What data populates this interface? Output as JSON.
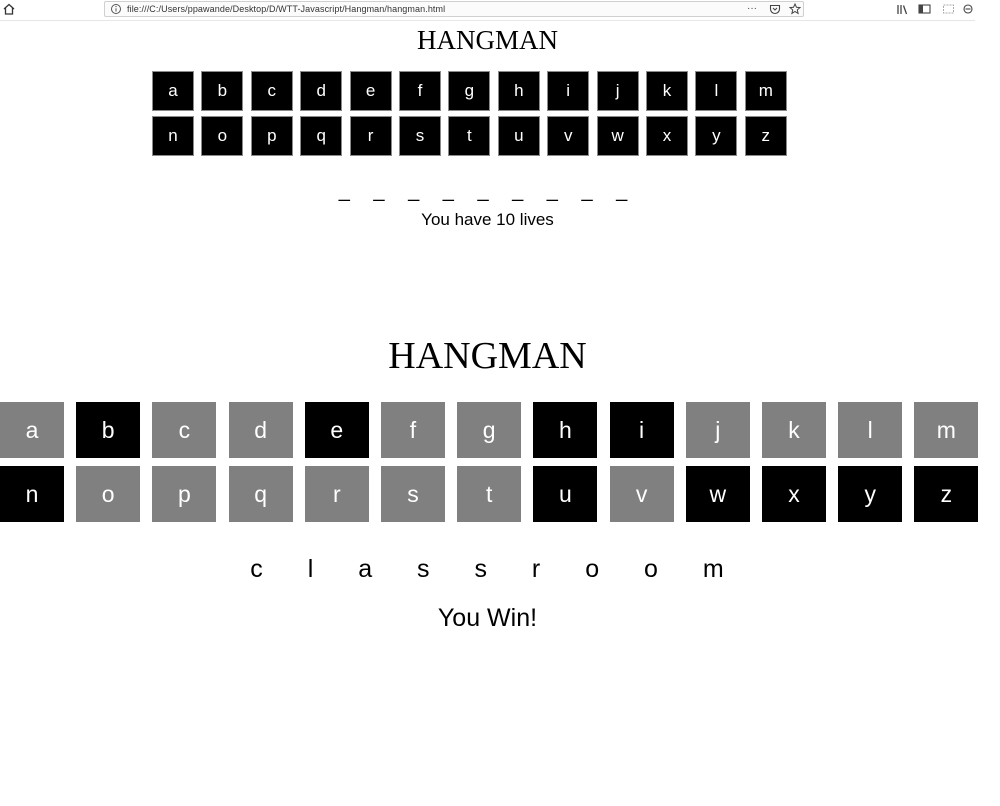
{
  "browser": {
    "url": "file:///C:/Users/ppawande/Desktop/D/WTT-Javascript/Hangman/hangman.html",
    "more_label": "···"
  },
  "top_game": {
    "title": "HANGMAN",
    "letters": [
      "a",
      "b",
      "c",
      "d",
      "e",
      "f",
      "g",
      "h",
      "i",
      "j",
      "k",
      "l",
      "m",
      "n",
      "o",
      "p",
      "q",
      "r",
      "s",
      "t",
      "u",
      "v",
      "w",
      "x",
      "y",
      "z"
    ],
    "word_display": "_ _ _ _ _ _ _ _ _",
    "status": "You have 10 lives"
  },
  "bottom_game": {
    "title": "HANGMAN",
    "letters": [
      "a",
      "b",
      "c",
      "d",
      "e",
      "f",
      "g",
      "h",
      "i",
      "j",
      "k",
      "l",
      "m",
      "n",
      "o",
      "p",
      "q",
      "r",
      "s",
      "t",
      "u",
      "v",
      "w",
      "x",
      "y",
      "z"
    ],
    "used_letters": [
      "a",
      "c",
      "d",
      "f",
      "g",
      "j",
      "k",
      "l",
      "m",
      "o",
      "p",
      "q",
      "r",
      "s",
      "t",
      "v"
    ],
    "word_display": "c l a s s r o o m",
    "status": "You Win!"
  },
  "colors": {
    "used_key": "#808080",
    "unused_key": "#000000",
    "key_text": "#ffffff"
  }
}
